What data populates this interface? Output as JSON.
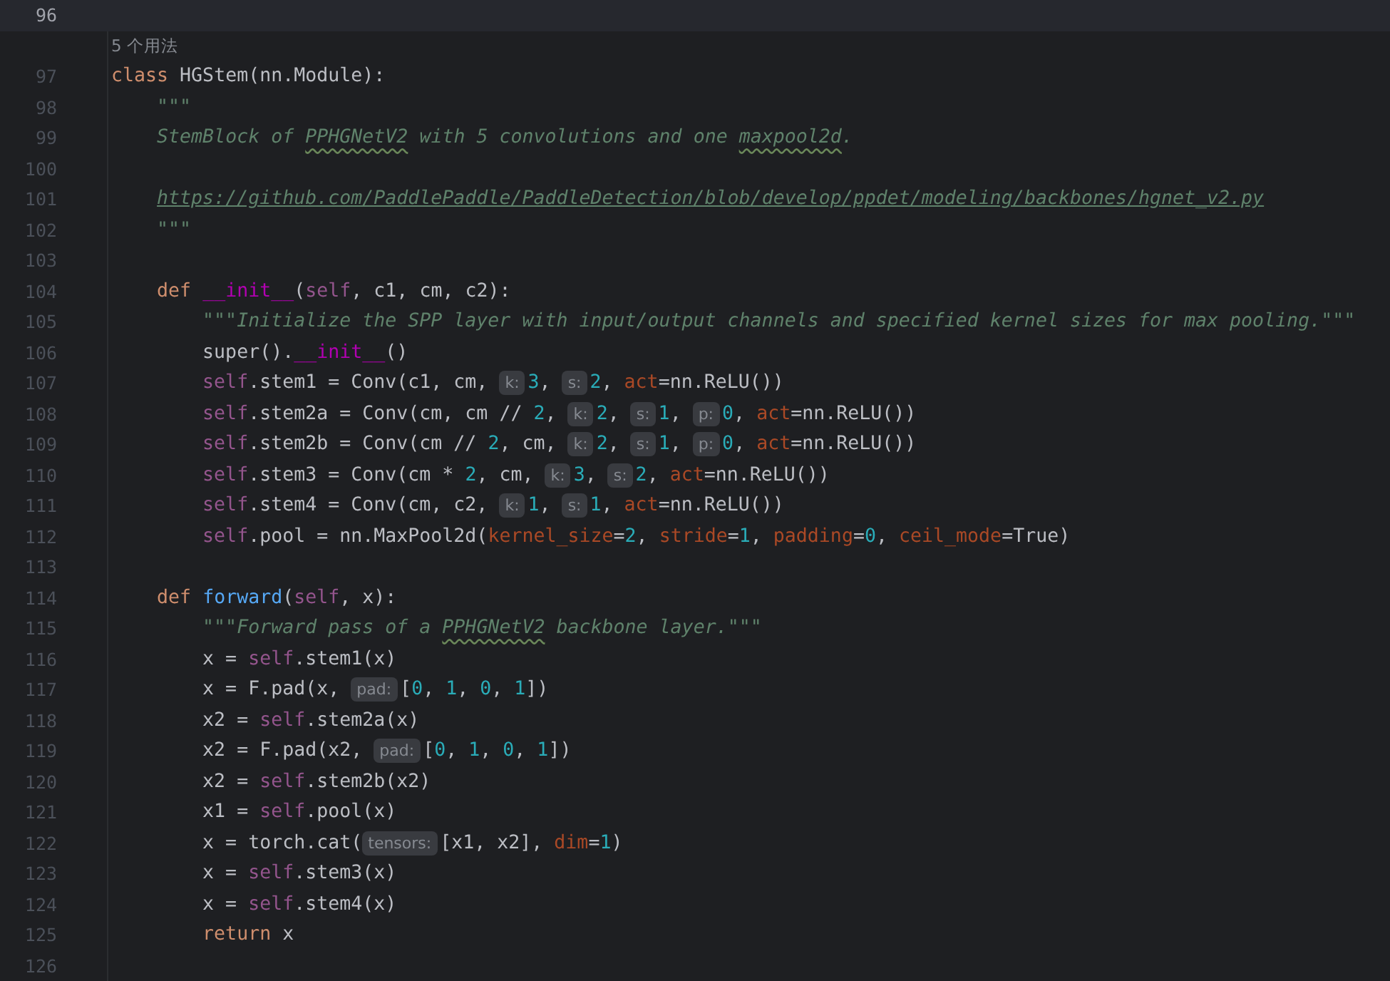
{
  "editor": {
    "lines": [
      {
        "kind": "code",
        "number": "96",
        "current": true
      },
      {
        "kind": "usage",
        "text": "5 个用法",
        "current": false
      },
      {
        "kind": "code",
        "number": "97",
        "current": false,
        "segments": [
          {
            "kind": "code",
            "tokens": [
              {
                "kind": "kw",
                "text": "class "
              },
              {
                "kind": "plain",
                "text": "HGStem(nn.Module):"
              }
            ]
          }
        ]
      },
      {
        "kind": "code",
        "number": "98",
        "current": false,
        "segments": [
          {
            "kind": "code",
            "tokens": [
              {
                "kind": "doc",
                "text": "    \"\"\""
              }
            ]
          }
        ]
      },
      {
        "kind": "code",
        "number": "99",
        "current": false,
        "segments": [
          {
            "kind": "code",
            "tokens": [
              {
                "kind": "doc",
                "text": "    StemBlock of "
              },
              {
                "kind": "typo",
                "text": "PPHGNetV2"
              },
              {
                "kind": "doc",
                "text": " with 5 convolutions and one "
              },
              {
                "kind": "typo",
                "text": "maxpool2d"
              },
              {
                "kind": "doc",
                "text": "."
              }
            ]
          }
        ]
      },
      {
        "kind": "code",
        "number": "100",
        "current": false
      },
      {
        "kind": "code",
        "number": "101",
        "current": false,
        "segments": [
          {
            "kind": "code",
            "tokens": [
              {
                "kind": "link",
                "text": "    https://github.com/PaddlePaddle/PaddleDetection/blob/develop/ppdet/modeling/backbones/hgnet_v2.py"
              }
            ]
          }
        ]
      },
      {
        "kind": "code",
        "number": "102",
        "current": false,
        "segments": [
          {
            "kind": "code",
            "tokens": [
              {
                "kind": "doc",
                "text": "    \"\"\""
              }
            ]
          }
        ]
      },
      {
        "kind": "code",
        "number": "103",
        "current": false
      },
      {
        "kind": "code",
        "number": "104",
        "current": false,
        "segments": [
          {
            "kind": "code",
            "tokens": [
              {
                "kind": "kw",
                "text": "    def "
              },
              {
                "kind": "dunder",
                "text": "__init__"
              },
              {
                "kind": "plain",
                "text": "("
              },
              {
                "kind": "self",
                "text": "self"
              },
              {
                "kind": "plain",
                "text": ", c1, cm, c2):"
              }
            ]
          }
        ]
      },
      {
        "kind": "code",
        "number": "105",
        "current": false,
        "segments": [
          {
            "kind": "code",
            "tokens": [
              {
                "kind": "doc",
                "text": "        \"\"\"Initialize the SPP layer with input/output channels and specified kernel sizes for max pooling.\"\"\""
              }
            ]
          }
        ]
      },
      {
        "kind": "code",
        "number": "106",
        "current": false,
        "segments": [
          {
            "kind": "code",
            "tokens": [
              {
                "kind": "plain",
                "text": "        super()."
              },
              {
                "kind": "dunder",
                "text": "__init__"
              },
              {
                "kind": "plain",
                "text": "()"
              }
            ]
          }
        ]
      },
      {
        "kind": "code",
        "number": "107",
        "current": false,
        "segments": [
          {
            "kind": "code",
            "tokens": [
              {
                "kind": "self",
                "text": "        self"
              },
              {
                "kind": "plain",
                "text": ".stem1 = Conv(c1, cm, "
              }
            ]
          },
          {
            "kind": "hint",
            "text": "k:"
          },
          {
            "kind": "code",
            "tokens": [
              {
                "kind": "num",
                "text": "3"
              },
              {
                "kind": "plain",
                "text": ", "
              }
            ]
          },
          {
            "kind": "hint",
            "text": "s:"
          },
          {
            "kind": "code",
            "tokens": [
              {
                "kind": "num",
                "text": "2"
              },
              {
                "kind": "plain",
                "text": ", "
              },
              {
                "kind": "param",
                "text": "act"
              },
              {
                "kind": "plain",
                "text": "=nn.ReLU())"
              }
            ]
          }
        ]
      },
      {
        "kind": "code",
        "number": "108",
        "current": false,
        "segments": [
          {
            "kind": "code",
            "tokens": [
              {
                "kind": "self",
                "text": "        self"
              },
              {
                "kind": "plain",
                "text": ".stem2a = Conv(cm, cm // "
              },
              {
                "kind": "num",
                "text": "2"
              },
              {
                "kind": "plain",
                "text": ", "
              }
            ]
          },
          {
            "kind": "hint",
            "text": "k:"
          },
          {
            "kind": "code",
            "tokens": [
              {
                "kind": "num",
                "text": "2"
              },
              {
                "kind": "plain",
                "text": ", "
              }
            ]
          },
          {
            "kind": "hint",
            "text": "s:"
          },
          {
            "kind": "code",
            "tokens": [
              {
                "kind": "num",
                "text": "1"
              },
              {
                "kind": "plain",
                "text": ", "
              }
            ]
          },
          {
            "kind": "hint",
            "text": "p:"
          },
          {
            "kind": "code",
            "tokens": [
              {
                "kind": "num",
                "text": "0"
              },
              {
                "kind": "plain",
                "text": ", "
              },
              {
                "kind": "param",
                "text": "act"
              },
              {
                "kind": "plain",
                "text": "=nn.ReLU())"
              }
            ]
          }
        ]
      },
      {
        "kind": "code",
        "number": "109",
        "current": false,
        "segments": [
          {
            "kind": "code",
            "tokens": [
              {
                "kind": "self",
                "text": "        self"
              },
              {
                "kind": "plain",
                "text": ".stem2b = Conv(cm // "
              },
              {
                "kind": "num",
                "text": "2"
              },
              {
                "kind": "plain",
                "text": ", cm, "
              }
            ]
          },
          {
            "kind": "hint",
            "text": "k:"
          },
          {
            "kind": "code",
            "tokens": [
              {
                "kind": "num",
                "text": "2"
              },
              {
                "kind": "plain",
                "text": ", "
              }
            ]
          },
          {
            "kind": "hint",
            "text": "s:"
          },
          {
            "kind": "code",
            "tokens": [
              {
                "kind": "num",
                "text": "1"
              },
              {
                "kind": "plain",
                "text": ", "
              }
            ]
          },
          {
            "kind": "hint",
            "text": "p:"
          },
          {
            "kind": "code",
            "tokens": [
              {
                "kind": "num",
                "text": "0"
              },
              {
                "kind": "plain",
                "text": ", "
              },
              {
                "kind": "param",
                "text": "act"
              },
              {
                "kind": "plain",
                "text": "=nn.ReLU())"
              }
            ]
          }
        ]
      },
      {
        "kind": "code",
        "number": "110",
        "current": false,
        "segments": [
          {
            "kind": "code",
            "tokens": [
              {
                "kind": "self",
                "text": "        self"
              },
              {
                "kind": "plain",
                "text": ".stem3 = Conv(cm * "
              },
              {
                "kind": "num",
                "text": "2"
              },
              {
                "kind": "plain",
                "text": ", cm, "
              }
            ]
          },
          {
            "kind": "hint",
            "text": "k:"
          },
          {
            "kind": "code",
            "tokens": [
              {
                "kind": "num",
                "text": "3"
              },
              {
                "kind": "plain",
                "text": ", "
              }
            ]
          },
          {
            "kind": "hint",
            "text": "s:"
          },
          {
            "kind": "code",
            "tokens": [
              {
                "kind": "num",
                "text": "2"
              },
              {
                "kind": "plain",
                "text": ", "
              },
              {
                "kind": "param",
                "text": "act"
              },
              {
                "kind": "plain",
                "text": "=nn.ReLU())"
              }
            ]
          }
        ]
      },
      {
        "kind": "code",
        "number": "111",
        "current": false,
        "segments": [
          {
            "kind": "code",
            "tokens": [
              {
                "kind": "self",
                "text": "        self"
              },
              {
                "kind": "plain",
                "text": ".stem4 = Conv(cm, c2, "
              }
            ]
          },
          {
            "kind": "hint",
            "text": "k:"
          },
          {
            "kind": "code",
            "tokens": [
              {
                "kind": "num",
                "text": "1"
              },
              {
                "kind": "plain",
                "text": ", "
              }
            ]
          },
          {
            "kind": "hint",
            "text": "s:"
          },
          {
            "kind": "code",
            "tokens": [
              {
                "kind": "num",
                "text": "1"
              },
              {
                "kind": "plain",
                "text": ", "
              },
              {
                "kind": "param",
                "text": "act"
              },
              {
                "kind": "plain",
                "text": "=nn.ReLU())"
              }
            ]
          }
        ]
      },
      {
        "kind": "code",
        "number": "112",
        "current": false,
        "segments": [
          {
            "kind": "code",
            "tokens": [
              {
                "kind": "self",
                "text": "        self"
              },
              {
                "kind": "plain",
                "text": ".pool = nn.MaxPool2d("
              },
              {
                "kind": "param",
                "text": "kernel_size"
              },
              {
                "kind": "plain",
                "text": "="
              },
              {
                "kind": "num",
                "text": "2"
              },
              {
                "kind": "plain",
                "text": ", "
              },
              {
                "kind": "param",
                "text": "stride"
              },
              {
                "kind": "plain",
                "text": "="
              },
              {
                "kind": "num",
                "text": "1"
              },
              {
                "kind": "plain",
                "text": ", "
              },
              {
                "kind": "param",
                "text": "padding"
              },
              {
                "kind": "plain",
                "text": "="
              },
              {
                "kind": "num",
                "text": "0"
              },
              {
                "kind": "plain",
                "text": ", "
              },
              {
                "kind": "param",
                "text": "ceil_mode"
              },
              {
                "kind": "plain",
                "text": "=True)"
              }
            ]
          }
        ]
      },
      {
        "kind": "code",
        "number": "113",
        "current": false
      },
      {
        "kind": "code",
        "number": "114",
        "current": false,
        "segments": [
          {
            "kind": "code",
            "tokens": [
              {
                "kind": "kw",
                "text": "    def "
              },
              {
                "kind": "fn",
                "text": "forward"
              },
              {
                "kind": "plain",
                "text": "("
              },
              {
                "kind": "self",
                "text": "self"
              },
              {
                "kind": "plain",
                "text": ", x):"
              }
            ]
          }
        ]
      },
      {
        "kind": "code",
        "number": "115",
        "current": false,
        "segments": [
          {
            "kind": "code",
            "tokens": [
              {
                "kind": "doc",
                "text": "        \"\"\"Forward pass of a "
              },
              {
                "kind": "typo",
                "text": "PPHGNetV2"
              },
              {
                "kind": "doc",
                "text": " backbone layer.\"\"\""
              }
            ]
          }
        ]
      },
      {
        "kind": "code",
        "number": "116",
        "current": false,
        "segments": [
          {
            "kind": "code",
            "tokens": [
              {
                "kind": "plain",
                "text": "        x = "
              },
              {
                "kind": "self",
                "text": "self"
              },
              {
                "kind": "plain",
                "text": ".stem1(x)"
              }
            ]
          }
        ]
      },
      {
        "kind": "code",
        "number": "117",
        "current": false,
        "segments": [
          {
            "kind": "code",
            "tokens": [
              {
                "kind": "plain",
                "text": "        x = F.pad(x, "
              }
            ]
          },
          {
            "kind": "hint",
            "text": "pad:"
          },
          {
            "kind": "code",
            "tokens": [
              {
                "kind": "plain",
                "text": "["
              },
              {
                "kind": "num",
                "text": "0"
              },
              {
                "kind": "plain",
                "text": ", "
              },
              {
                "kind": "num",
                "text": "1"
              },
              {
                "kind": "plain",
                "text": ", "
              },
              {
                "kind": "num",
                "text": "0"
              },
              {
                "kind": "plain",
                "text": ", "
              },
              {
                "kind": "num",
                "text": "1"
              },
              {
                "kind": "plain",
                "text": "])"
              }
            ]
          }
        ]
      },
      {
        "kind": "code",
        "number": "118",
        "current": false,
        "segments": [
          {
            "kind": "code",
            "tokens": [
              {
                "kind": "plain",
                "text": "        x2 = "
              },
              {
                "kind": "self",
                "text": "self"
              },
              {
                "kind": "plain",
                "text": ".stem2a(x)"
              }
            ]
          }
        ]
      },
      {
        "kind": "code",
        "number": "119",
        "current": false,
        "segments": [
          {
            "kind": "code",
            "tokens": [
              {
                "kind": "plain",
                "text": "        x2 = F.pad(x2, "
              }
            ]
          },
          {
            "kind": "hint",
            "text": "pad:"
          },
          {
            "kind": "code",
            "tokens": [
              {
                "kind": "plain",
                "text": "["
              },
              {
                "kind": "num",
                "text": "0"
              },
              {
                "kind": "plain",
                "text": ", "
              },
              {
                "kind": "num",
                "text": "1"
              },
              {
                "kind": "plain",
                "text": ", "
              },
              {
                "kind": "num",
                "text": "0"
              },
              {
                "kind": "plain",
                "text": ", "
              },
              {
                "kind": "num",
                "text": "1"
              },
              {
                "kind": "plain",
                "text": "])"
              }
            ]
          }
        ]
      },
      {
        "kind": "code",
        "number": "120",
        "current": false,
        "segments": [
          {
            "kind": "code",
            "tokens": [
              {
                "kind": "plain",
                "text": "        x2 = "
              },
              {
                "kind": "self",
                "text": "self"
              },
              {
                "kind": "plain",
                "text": ".stem2b(x2)"
              }
            ]
          }
        ]
      },
      {
        "kind": "code",
        "number": "121",
        "current": false,
        "segments": [
          {
            "kind": "code",
            "tokens": [
              {
                "kind": "plain",
                "text": "        x1 = "
              },
              {
                "kind": "self",
                "text": "self"
              },
              {
                "kind": "plain",
                "text": ".pool(x)"
              }
            ]
          }
        ]
      },
      {
        "kind": "code",
        "number": "122",
        "current": false,
        "segments": [
          {
            "kind": "code",
            "tokens": [
              {
                "kind": "plain",
                "text": "        x = torch.cat("
              }
            ]
          },
          {
            "kind": "hint",
            "text": "tensors:"
          },
          {
            "kind": "code",
            "tokens": [
              {
                "kind": "plain",
                "text": "[x1, x2], "
              },
              {
                "kind": "param",
                "text": "dim"
              },
              {
                "kind": "plain",
                "text": "="
              },
              {
                "kind": "num",
                "text": "1"
              },
              {
                "kind": "plain",
                "text": ")"
              }
            ]
          }
        ]
      },
      {
        "kind": "code",
        "number": "123",
        "current": false,
        "segments": [
          {
            "kind": "code",
            "tokens": [
              {
                "kind": "plain",
                "text": "        x = "
              },
              {
                "kind": "self",
                "text": "self"
              },
              {
                "kind": "plain",
                "text": ".stem3(x)"
              }
            ]
          }
        ]
      },
      {
        "kind": "code",
        "number": "124",
        "current": false,
        "segments": [
          {
            "kind": "code",
            "tokens": [
              {
                "kind": "plain",
                "text": "        x = "
              },
              {
                "kind": "self",
                "text": "self"
              },
              {
                "kind": "plain",
                "text": ".stem4(x)"
              }
            ]
          }
        ]
      },
      {
        "kind": "code",
        "number": "125",
        "current": false,
        "segments": [
          {
            "kind": "code",
            "tokens": [
              {
                "kind": "kw",
                "text": "        return "
              },
              {
                "kind": "plain",
                "text": "x"
              }
            ]
          }
        ]
      },
      {
        "kind": "code",
        "number": "126",
        "current": false
      }
    ]
  }
}
